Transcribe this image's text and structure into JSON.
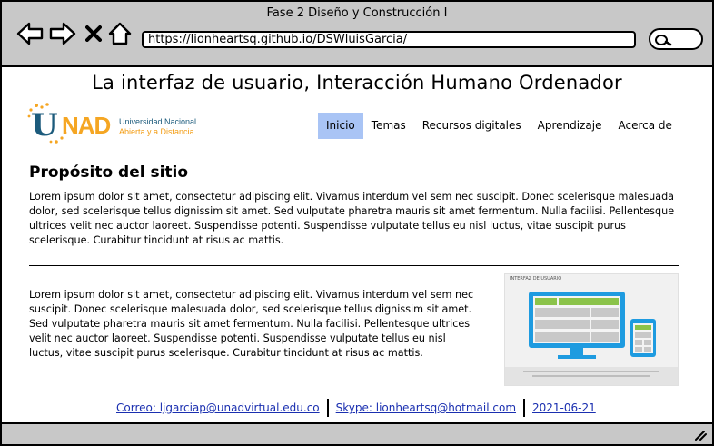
{
  "window": {
    "title": "Fase 2 Diseño y Construcción I"
  },
  "browser": {
    "url": "https://lionheartsq.github.io/DSWluisGarcia/"
  },
  "page": {
    "title": "La interfaz de usuario, Interacción Humano Ordenador"
  },
  "logo": {
    "u": "U",
    "nad": "NAD",
    "line1": "Universidad Nacional",
    "line2": "Abierta y a Distancia",
    "colors": {
      "primary": "#1c5b7c",
      "accent": "#f5a623"
    }
  },
  "menu": {
    "items": [
      {
        "label": "Inicio",
        "active": true
      },
      {
        "label": "Temas",
        "active": false
      },
      {
        "label": "Recursos digitales",
        "active": false
      },
      {
        "label": "Aprendizaje",
        "active": false
      },
      {
        "label": "Acerca de",
        "active": false
      }
    ],
    "active_color": "#a9c4f5"
  },
  "section": {
    "title": "Propósito del sitio",
    "paragraph1": "Lorem ipsum dolor sit amet, consectetur adipiscing elit. Vivamus interdum vel sem nec suscipit. Donec scelerisque malesuada dolor, sed scelerisque tellus dignissim sit amet. Sed vulputate pharetra mauris sit amet fermentum. Nulla facilisi. Pellentesque ultrices velit nec auctor laoreet. Suspendisse potenti. Suspendisse vulputate tellus eu nisl luctus, vitae suscipit purus scelerisque. Curabitur tincidunt at risus ac mattis.",
    "paragraph2": "Lorem ipsum dolor sit amet, consectetur adipiscing elit. Vivamus interdum vel sem nec suscipit. Donec scelerisque malesuada dolor, sed scelerisque tellus dignissim sit amet. Sed vulputate pharetra mauris sit amet fermentum. Nulla facilisi. Pellentesque ultrices velit nec auctor laoreet. Suspendisse potenti. Suspendisse vulputate tellus eu nisl luctus, vitae suscipit purus scelerisque. Curabitur tincidunt at risus ac mattis."
  },
  "image": {
    "caption": "INTERFAZ DE USUARIO",
    "colors": {
      "device": "#1e9be0",
      "block": "#8bc34a",
      "panel": "#c8c8c8"
    }
  },
  "footer": {
    "email": "Correo: ljgarciap@unadvirtual.edu.co",
    "skype": "Skype: lionheartsq@hotmail.com",
    "date": "2021-06-21"
  }
}
